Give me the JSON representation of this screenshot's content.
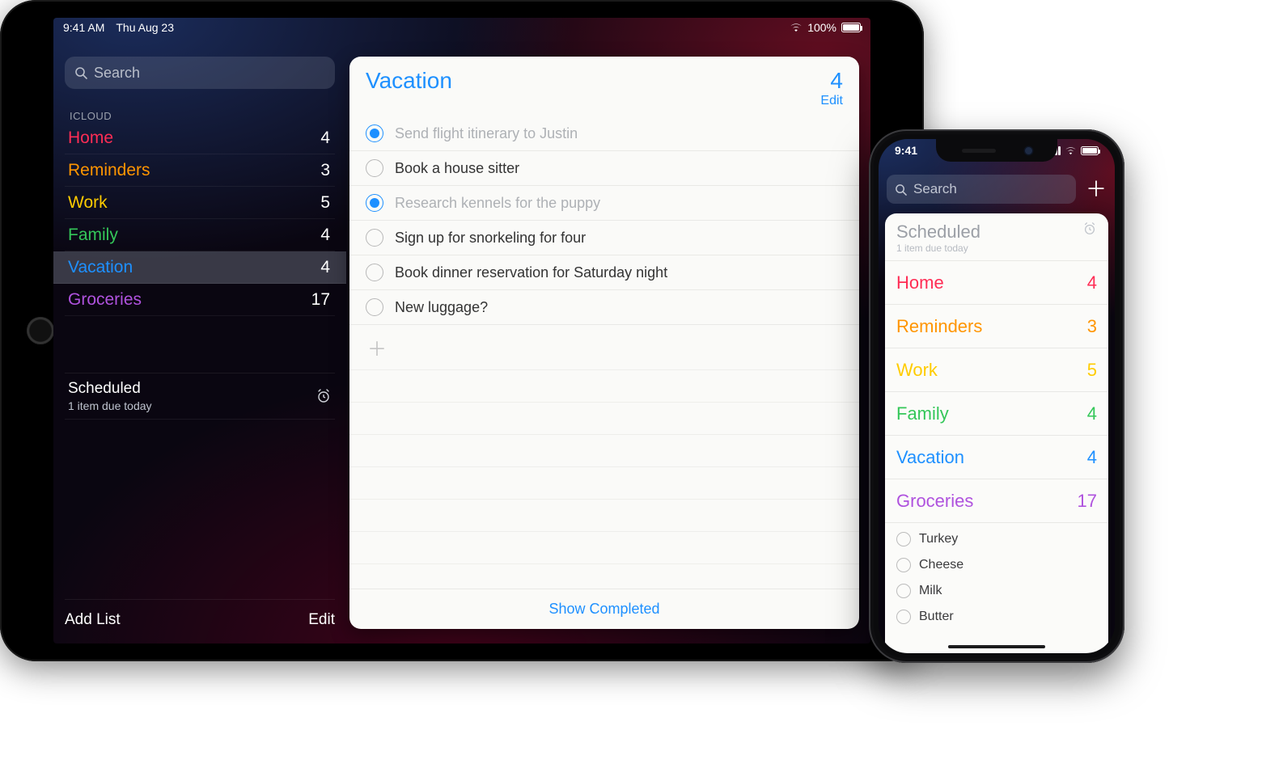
{
  "ipad": {
    "status": {
      "time": "9:41 AM",
      "date": "Thu Aug 23",
      "battery": "100%"
    },
    "search_placeholder": "Search",
    "section": "ICLOUD",
    "lists": [
      {
        "name": "Home",
        "count": 4,
        "color": "c-home"
      },
      {
        "name": "Reminders",
        "count": 3,
        "color": "c-reminders"
      },
      {
        "name": "Work",
        "count": 5,
        "color": "c-work"
      },
      {
        "name": "Family",
        "count": 4,
        "color": "c-family"
      },
      {
        "name": "Vacation",
        "count": 4,
        "color": "c-vacation",
        "selected": true
      },
      {
        "name": "Groceries",
        "count": 17,
        "color": "c-groceries"
      }
    ],
    "scheduled": {
      "title": "Scheduled",
      "subtitle": "1 item due today"
    },
    "footer": {
      "add": "Add List",
      "edit": "Edit"
    },
    "detail": {
      "title": "Vacation",
      "count": 4,
      "edit": "Edit",
      "tasks": [
        {
          "text": "Send flight itinerary to Justin",
          "done": true
        },
        {
          "text": "Book a house sitter",
          "done": false
        },
        {
          "text": "Research kennels for the puppy",
          "done": true
        },
        {
          "text": "Sign up for snorkeling for four",
          "done": false
        },
        {
          "text": "Book dinner reservation for Saturday night",
          "done": false
        },
        {
          "text": "New luggage?",
          "done": false
        }
      ],
      "show_completed": "Show Completed"
    }
  },
  "iphone": {
    "status_time": "9:41",
    "search_placeholder": "Search",
    "scheduled": {
      "title": "Scheduled",
      "subtitle": "1 item due today"
    },
    "lists": [
      {
        "name": "Home",
        "count": 4,
        "color": "c-home"
      },
      {
        "name": "Reminders",
        "count": 3,
        "color": "c-reminders"
      },
      {
        "name": "Work",
        "count": 5,
        "color": "c-work"
      },
      {
        "name": "Family",
        "count": 4,
        "color": "c-family"
      },
      {
        "name": "Vacation",
        "count": 4,
        "color": "c-vacation"
      },
      {
        "name": "Groceries",
        "count": 17,
        "color": "c-groceries"
      }
    ],
    "grocery_items": [
      "Turkey",
      "Cheese",
      "Milk",
      "Butter"
    ]
  }
}
